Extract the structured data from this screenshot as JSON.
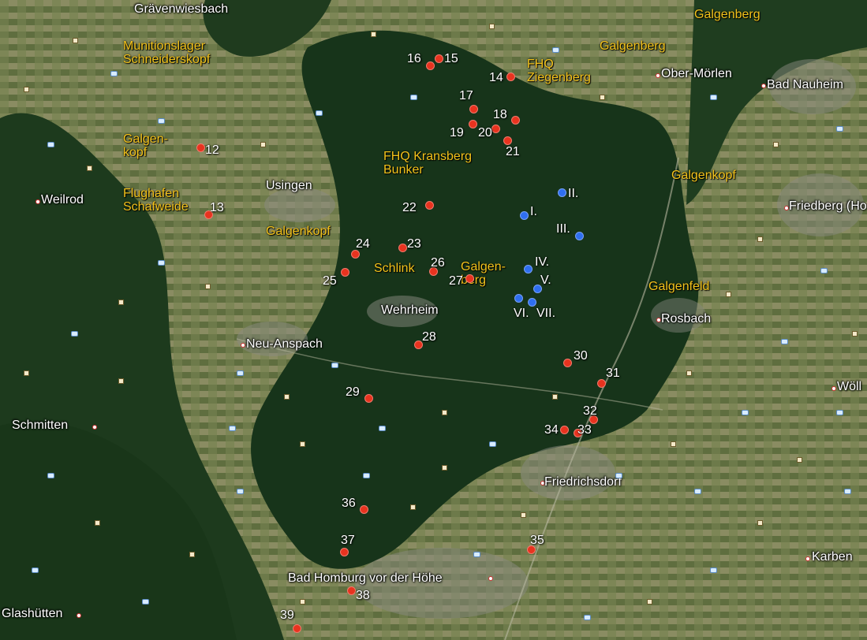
{
  "colors": {
    "forest": "#1f3d1f",
    "field": "#6f7a4c",
    "town": "#8a8a80",
    "poi_text": "#f2c21b",
    "red_marker": "#e8331f",
    "blue_marker": "#2f6ff0"
  },
  "towns": [
    {
      "id": "graevenwiesbach",
      "text": "Grävenwiesbach"
    },
    {
      "id": "ober-moerlen",
      "text": "Ober-Mörlen"
    },
    {
      "id": "bad-nauheim",
      "text": "Bad Nauheim"
    },
    {
      "id": "usingen",
      "text": "Usingen"
    },
    {
      "id": "weilrod",
      "text": "Weilrod"
    },
    {
      "id": "friedberg",
      "text": "Friedberg (Ho"
    },
    {
      "id": "wehrheim",
      "text": "Wehrheim"
    },
    {
      "id": "rosbach",
      "text": "Rosbach"
    },
    {
      "id": "neu-anspach",
      "text": "Neu-Anspach"
    },
    {
      "id": "schmitten",
      "text": "Schmitten"
    },
    {
      "id": "woell",
      "text": "Wöll"
    },
    {
      "id": "friedrichsdorf",
      "text": "Friedrichsdorf"
    },
    {
      "id": "karben",
      "text": "Karben"
    },
    {
      "id": "bad-homburg",
      "text": "Bad Homburg vor der Höhe"
    },
    {
      "id": "glashuetten",
      "text": "Glashütten"
    }
  ],
  "pois": [
    {
      "id": "galgenberg-ne",
      "text": "Galgenberg"
    },
    {
      "id": "munitionslager",
      "text": "Munitionslager\nSchneiderskopf"
    },
    {
      "id": "galgenberg-n",
      "text": "Galgenberg"
    },
    {
      "id": "fhq-ziegenberg",
      "text": "FHQ\nZiegenberg"
    },
    {
      "id": "galgenkopf-w",
      "text": "Galgen-\nkopf"
    },
    {
      "id": "fhq-kransberg",
      "text": "FHQ Kransberg\nBunker"
    },
    {
      "id": "galgenkopf-e",
      "text": "Galgenkopf"
    },
    {
      "id": "flughafen",
      "text": "Flughafen\nSchafweide"
    },
    {
      "id": "galgenkopf-c",
      "text": "Galgenkopf"
    },
    {
      "id": "schlink",
      "text": "Schlink"
    },
    {
      "id": "galgenberg-c",
      "text": "Galgen-\nberg"
    },
    {
      "id": "galgenfeld",
      "text": "Galgenfeld"
    }
  ],
  "red_points": [
    {
      "id": "12",
      "label": "12"
    },
    {
      "id": "13",
      "label": "13"
    },
    {
      "id": "14",
      "label": "14"
    },
    {
      "id": "15",
      "label": "15"
    },
    {
      "id": "16",
      "label": "16"
    },
    {
      "id": "17",
      "label": "17"
    },
    {
      "id": "18",
      "label": "18"
    },
    {
      "id": "19",
      "label": "19"
    },
    {
      "id": "20",
      "label": "20"
    },
    {
      "id": "21",
      "label": "21"
    },
    {
      "id": "22",
      "label": "22"
    },
    {
      "id": "23",
      "label": "23"
    },
    {
      "id": "24",
      "label": "24"
    },
    {
      "id": "25",
      "label": "25"
    },
    {
      "id": "26",
      "label": "26"
    },
    {
      "id": "27",
      "label": "27"
    },
    {
      "id": "28",
      "label": "28"
    },
    {
      "id": "29",
      "label": "29"
    },
    {
      "id": "30",
      "label": "30"
    },
    {
      "id": "31",
      "label": "31"
    },
    {
      "id": "32",
      "label": "32"
    },
    {
      "id": "33",
      "label": "33"
    },
    {
      "id": "34",
      "label": "34"
    },
    {
      "id": "35",
      "label": "35"
    },
    {
      "id": "36",
      "label": "36"
    },
    {
      "id": "37",
      "label": "37"
    },
    {
      "id": "38",
      "label": "38"
    },
    {
      "id": "39",
      "label": "39"
    }
  ],
  "blue_points": [
    {
      "id": "I",
      "label": "I."
    },
    {
      "id": "II",
      "label": "II."
    },
    {
      "id": "III",
      "label": "III."
    },
    {
      "id": "IV",
      "label": "IV."
    },
    {
      "id": "V",
      "label": "V."
    },
    {
      "id": "VI",
      "label": "VI."
    },
    {
      "id": "VII",
      "label": "VII."
    }
  ]
}
